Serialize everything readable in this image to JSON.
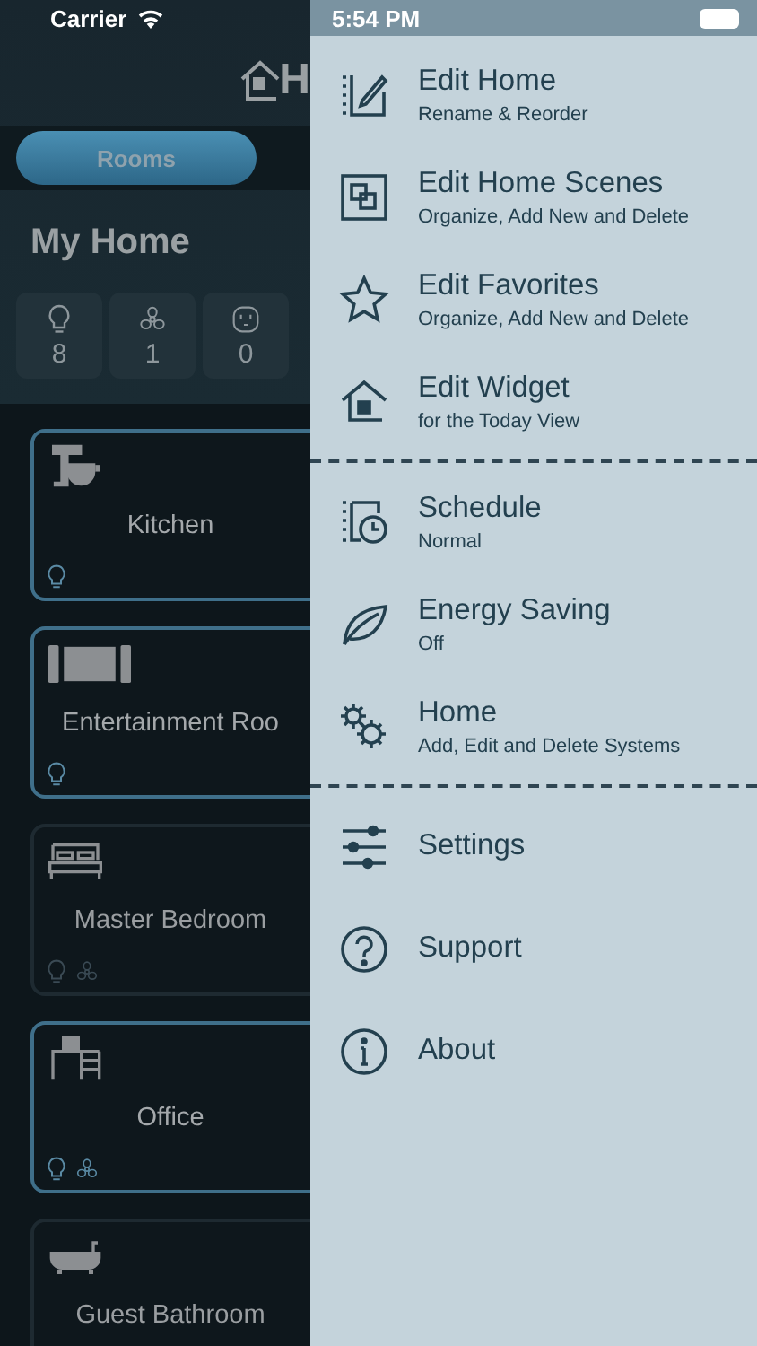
{
  "status_bar": {
    "carrier": "Carrier",
    "time": "5:54 PM"
  },
  "header": {
    "title": "H"
  },
  "tabs": [
    {
      "label": "Rooms",
      "selected": true
    }
  ],
  "home": {
    "title": "My Home",
    "stats": [
      {
        "kind": "bulb",
        "count": "8"
      },
      {
        "kind": "fan",
        "count": "1"
      },
      {
        "kind": "outlet",
        "count": "0"
      }
    ]
  },
  "rooms": [
    {
      "name": "Kitchen",
      "kind": "mixer",
      "active": true,
      "light": true,
      "fan": false
    },
    {
      "name": "Entertainment Roo",
      "kind": "tv",
      "active": true,
      "light": true,
      "fan": false
    },
    {
      "name": "Master Bedroom",
      "kind": "bed",
      "active": false,
      "light": true,
      "fan": true
    },
    {
      "name": "Office",
      "kind": "desk",
      "active": true,
      "light": true,
      "fan": true
    },
    {
      "name": "Guest Bathroom",
      "kind": "bath",
      "active": false
    }
  ],
  "menu": {
    "sections": [
      {
        "items": [
          {
            "kind": "edit",
            "title": "Edit Home",
            "subtitle": "Rename & Reorder"
          },
          {
            "kind": "scenes",
            "title": "Edit Home Scenes",
            "subtitle": "Organize, Add New and Delete"
          },
          {
            "kind": "star",
            "title": "Edit Favorites",
            "subtitle": "Organize, Add New and Delete"
          },
          {
            "kind": "widget",
            "title": "Edit Widget",
            "subtitle": "for the Today View"
          }
        ]
      },
      {
        "items": [
          {
            "kind": "schedule",
            "title": "Schedule",
            "subtitle": "Normal"
          },
          {
            "kind": "leaf",
            "title": "Energy Saving",
            "subtitle": "Off"
          },
          {
            "kind": "gears",
            "title": "Home",
            "subtitle": "Add, Edit and Delete Systems"
          }
        ]
      },
      {
        "items": [
          {
            "kind": "sliders",
            "title": "Settings"
          },
          {
            "kind": "help",
            "title": "Support"
          },
          {
            "kind": "info",
            "title": "About"
          }
        ]
      }
    ]
  }
}
